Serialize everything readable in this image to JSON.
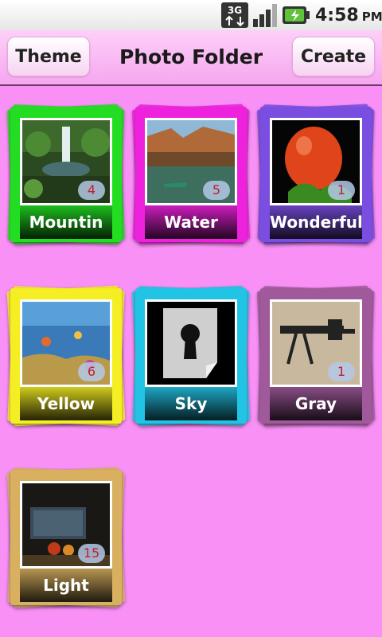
{
  "status_bar": {
    "network": "3G",
    "time": "4:58",
    "ampm": "PM"
  },
  "title_bar": {
    "theme_label": "Theme",
    "title": "Photo Folder",
    "create_label": "Create"
  },
  "folders": [
    {
      "name": "Mountin",
      "count": "4",
      "color": "#22dd22"
    },
    {
      "name": "Water",
      "count": "5",
      "color": "#ee22dd"
    },
    {
      "name": "Wonderful",
      "count": "1",
      "color": "#7a4ee0"
    },
    {
      "name": "Yellow",
      "count": "6",
      "color": "#f4ee22"
    },
    {
      "name": "Sky",
      "count": "",
      "color": "#22c4e6"
    },
    {
      "name": "Gray",
      "count": "1",
      "color": "#a05a9c"
    },
    {
      "name": "Light",
      "count": "15",
      "color": "#d8b060"
    }
  ]
}
